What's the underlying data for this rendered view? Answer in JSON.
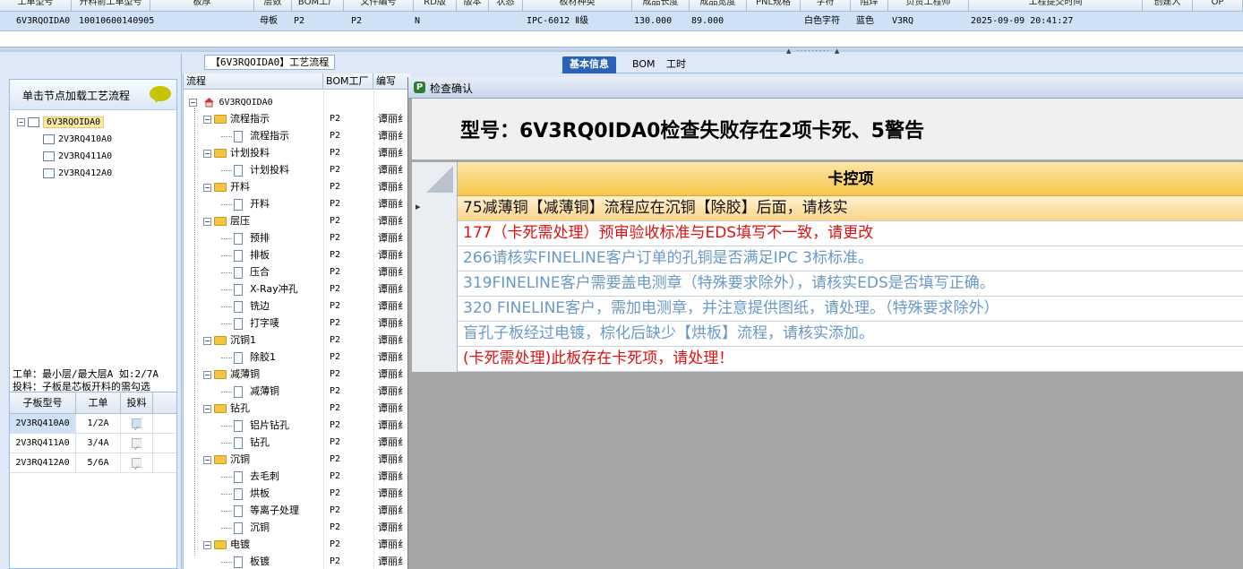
{
  "top_grid": {
    "headers": [
      "工单型号",
      "开料前工单型号",
      "板厚",
      "层数",
      "BOM工厂",
      "文件编号",
      "RD版",
      "版本",
      "状态",
      "板材种类",
      "成品长度",
      "成品宽度",
      "PNL规格",
      "字符",
      "阻焊",
      "负责工程师",
      "工程提交时间",
      "创建人",
      "OP"
    ],
    "row": {
      "model": "6V3RQOIDA0",
      "code": "10010600140905",
      "board": "母板",
      "p1": "P2",
      "p2": "P2",
      "n": "N",
      "material": "IPC-6012 Ⅱ级",
      "length": "130.000",
      "width": "89.000",
      "char": "白色字符",
      "mask": "蓝色",
      "eng": "V3RQ",
      "time": "2025-09-09 20:41:27"
    }
  },
  "left_panel": {
    "load_button": "单击节点加载工艺流程",
    "tree": {
      "root": "6V3RQOIDA0",
      "children": [
        "2V3RQ410A0",
        "2V3RQ411A0",
        "2V3RQ412A0"
      ]
    },
    "info_line1": "工单：最小层/最大层A 如:2/7A",
    "info_line2": "投料：子板是芯板开料的需勾选",
    "subgrid": {
      "headers": [
        "子板型号",
        "工单",
        "投料"
      ],
      "rows": [
        {
          "model": "2V3RQ410A0",
          "order": "1/2A",
          "feed": "✓"
        },
        {
          "model": "2V3RQ411A0",
          "order": "3/4A",
          "feed": "✓"
        },
        {
          "model": "2V3RQ412A0",
          "order": "5/6A",
          "feed": "✓"
        }
      ]
    }
  },
  "middle": {
    "tab_label": "【6V3RQOIDA0】工艺流程",
    "headers": [
      "流程",
      "BOM工厂",
      "编写"
    ],
    "root": "6V3RQOIDA0",
    "rows": [
      {
        "name": "流程指示",
        "bom": "P2",
        "author": "谭丽纟",
        "type": "folder"
      },
      {
        "name": "流程指示",
        "bom": "P2",
        "author": "谭丽纟",
        "type": "leaf"
      },
      {
        "name": "计划投料",
        "bom": "P2",
        "author": "谭丽纟",
        "type": "folder"
      },
      {
        "name": "计划投料",
        "bom": "P2",
        "author": "谭丽纟",
        "type": "leaf"
      },
      {
        "name": "开料",
        "bom": "P2",
        "author": "谭丽纟",
        "type": "folder"
      },
      {
        "name": "开料",
        "bom": "P2",
        "author": "谭丽纟",
        "type": "leaf"
      },
      {
        "name": "层压",
        "bom": "P2",
        "author": "谭丽纟",
        "type": "folder"
      },
      {
        "name": "预排",
        "bom": "P2",
        "author": "谭丽纟",
        "type": "leaf"
      },
      {
        "name": "排板",
        "bom": "P2",
        "author": "谭丽纟",
        "type": "leaf"
      },
      {
        "name": "压合",
        "bom": "P2",
        "author": "谭丽纟",
        "type": "leaf"
      },
      {
        "name": "X-Ray冲孔",
        "bom": "P2",
        "author": "谭丽纟",
        "type": "leaf"
      },
      {
        "name": "铣边",
        "bom": "P2",
        "author": "谭丽纟",
        "type": "leaf"
      },
      {
        "name": "打字唛",
        "bom": "P2",
        "author": "谭丽纟",
        "type": "leaf"
      },
      {
        "name": "沉铜1",
        "bom": "P2",
        "author": "谭丽纟",
        "type": "folder"
      },
      {
        "name": "除胶1",
        "bom": "P2",
        "author": "谭丽纟",
        "type": "leaf"
      },
      {
        "name": "减薄铜",
        "bom": "P2",
        "author": "谭丽纟",
        "type": "folder"
      },
      {
        "name": "减薄铜",
        "bom": "P2",
        "author": "谭丽纟",
        "type": "leaf"
      },
      {
        "name": "钻孔",
        "bom": "P2",
        "author": "谭丽纟",
        "type": "folder"
      },
      {
        "name": "铝片钻孔",
        "bom": "P2",
        "author": "谭丽纟",
        "type": "leaf"
      },
      {
        "name": "钻孔",
        "bom": "P2",
        "author": "谭丽纟",
        "type": "leaf"
      },
      {
        "name": "沉铜",
        "bom": "P2",
        "author": "谭丽纟",
        "type": "folder"
      },
      {
        "name": "去毛刺",
        "bom": "P2",
        "author": "谭丽纟",
        "type": "leaf"
      },
      {
        "name": "烘板",
        "bom": "P2",
        "author": "谭丽纟",
        "type": "leaf"
      },
      {
        "name": "等离子处理",
        "bom": "P2",
        "author": "谭丽纟",
        "type": "leaf"
      },
      {
        "name": "沉铜",
        "bom": "P2",
        "author": "谭丽纟",
        "type": "leaf"
      },
      {
        "name": "电镀",
        "bom": "P2",
        "author": "谭丽纟",
        "type": "folder"
      },
      {
        "name": "板镀",
        "bom": "P2",
        "author": "谭丽纟",
        "type": "leaf"
      }
    ]
  },
  "right_tabs": [
    "基本信息",
    "BOM",
    "工时"
  ],
  "dialog": {
    "title": "检查确认",
    "heading": "型号：6V3RQ0IDA0检查失败存在2项卡死、5警告",
    "column_header": "卡控项",
    "items": [
      {
        "text": "75减薄铜【减薄铜】流程应在沉铜【除胶】后面，请核实",
        "level": "dark"
      },
      {
        "text": "177（卡死需处理）预审验收标准与EDS填写不一致，请更改",
        "level": "red"
      },
      {
        "text": "266请核实FINELINE客户订单的孔铜是否满足IPC 3标标准。",
        "level": "blue"
      },
      {
        "text": "319FINELINE客户需要盖电测章（特殊要求除外），请核实EDS是否填写正确。",
        "level": "blue"
      },
      {
        "text": "320 FINELINE客户，需加电测章，并注意提供图纸，请处理。（特殊要求除外）",
        "level": "blue"
      },
      {
        "text": "盲孔子板经过电镀，棕化后缺少【烘板】流程，请核实添加。",
        "level": "blue"
      },
      {
        "text": "(卡死需处理)此板存在卡死项，请处理！",
        "level": "red"
      }
    ]
  },
  "colors": {
    "accent": "#2a62b8",
    "critical": "#e01010",
    "warning": "#6a98c8",
    "selected_row": "#cfe1f7"
  }
}
